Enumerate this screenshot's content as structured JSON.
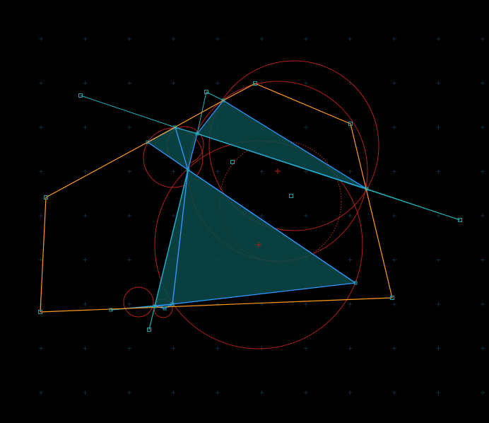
{
  "colors": {
    "background": "#000000",
    "grid_cross": "#0e2b3a",
    "hull": "#ff9a1f",
    "spokes": "#1fb5b5",
    "triangle_edge": "#2f96ff",
    "triangle_fill": "#0b4a4a",
    "circumcircle": "#b3201b",
    "circumcircle_dotted": "#c92a22",
    "vertex": "#2a9ea8"
  },
  "diagram": {
    "grid": {
      "visible": true,
      "marker": "cross"
    },
    "hull_vertices": [
      {
        "id": "H1",
        "p": [
          114,
          135
        ]
      },
      {
        "id": "H2",
        "p": [
          292,
          130
        ]
      },
      {
        "id": "H3",
        "p": [
          361,
          118
        ]
      },
      {
        "id": "H4",
        "p": [
          496,
          175
        ]
      },
      {
        "id": "H5",
        "p": [
          555,
          421
        ]
      },
      {
        "id": "H6",
        "p": [
          57,
          441
        ]
      },
      {
        "id": "H7",
        "p": [
          65,
          279
        ]
      },
      {
        "id": "H8",
        "p": [
          651,
          311
        ]
      },
      {
        "id": "H9",
        "p": [
          211,
          466
        ]
      }
    ],
    "hull_edges": [
      [
        "H3",
        "H4"
      ],
      [
        "H4",
        "H5"
      ],
      [
        "H5",
        "H6"
      ],
      [
        "H6",
        "H7"
      ],
      [
        "H7",
        "T1"
      ],
      [
        "T1",
        "T7"
      ],
      [
        "T7",
        "H3"
      ]
    ],
    "inner_points": [
      {
        "id": "Q1",
        "p": [
          329,
          229
        ]
      },
      {
        "id": "Q2",
        "p": [
          412,
          277
        ]
      }
    ],
    "triangle_vertices": [
      {
        "id": "T1",
        "p": [
          209,
          201
        ]
      },
      {
        "id": "T2",
        "p": [
          248,
          180
        ]
      },
      {
        "id": "T3",
        "p": [
          279,
          189
        ]
      },
      {
        "id": "T4",
        "p": [
          266,
          240
        ]
      },
      {
        "id": "T5",
        "p": [
          503,
          400
        ]
      },
      {
        "id": "T6",
        "p": [
          244,
          430
        ]
      },
      {
        "id": "T7",
        "p": [
          316,
          142
        ]
      },
      {
        "id": "T8",
        "p": [
          519,
          267
        ]
      },
      {
        "id": "T9",
        "p": [
          219,
          433
        ]
      },
      {
        "id": "T10",
        "p": [
          157,
          438
        ]
      },
      {
        "id": "T11",
        "p": [
          233,
          436
        ]
      }
    ],
    "triangles": [
      [
        "T1",
        "T2",
        "T4"
      ],
      [
        "T2",
        "T3",
        "T4"
      ],
      [
        "T3",
        "T7",
        "T8"
      ],
      [
        "T4",
        "T5",
        "T6"
      ],
      [
        "T4",
        "T6",
        "T9"
      ],
      [
        "T9",
        "T6",
        "T11"
      ]
    ],
    "extra_edges": [
      [
        "T3",
        "T8"
      ],
      [
        "T4",
        "T5"
      ],
      [
        "T10",
        "T6"
      ],
      [
        "T9",
        "T4"
      ]
    ],
    "spokes": [
      [
        "H1",
        "T2"
      ],
      [
        "T2",
        "T3"
      ],
      [
        "H2",
        "T3"
      ],
      [
        "H2",
        "T7"
      ],
      [
        "T3",
        "H8"
      ],
      [
        "T8",
        "H8"
      ],
      [
        "T4",
        "H9"
      ],
      [
        "H9",
        "T9"
      ],
      [
        "T10",
        "T9"
      ]
    ],
    "circles": [
      {
        "c": [
          366,
          346
        ],
        "r": 147,
        "style": "solid"
      },
      {
        "c": [
          393,
          242
        ],
        "r": 127,
        "style": "solid"
      },
      {
        "c": [
          416,
          206
        ],
        "r": 120,
        "style": "solid"
      },
      {
        "c": [
          397,
          285
        ],
        "r": 86,
        "style": "dotted"
      },
      {
        "c": [
          245,
          223
        ],
        "r": 42,
        "style": "solid"
      },
      {
        "c": [
          262,
          205
        ],
        "r": 26,
        "style": "solid"
      },
      {
        "c": [
          196,
          427
        ],
        "r": 21,
        "style": "solid"
      },
      {
        "c": [
          231,
          436
        ],
        "r": 13,
        "style": "solid"
      }
    ],
    "centers": [
      {
        "p": [
          393,
          242
        ]
      },
      {
        "p": [
          366,
          346
        ]
      }
    ]
  }
}
